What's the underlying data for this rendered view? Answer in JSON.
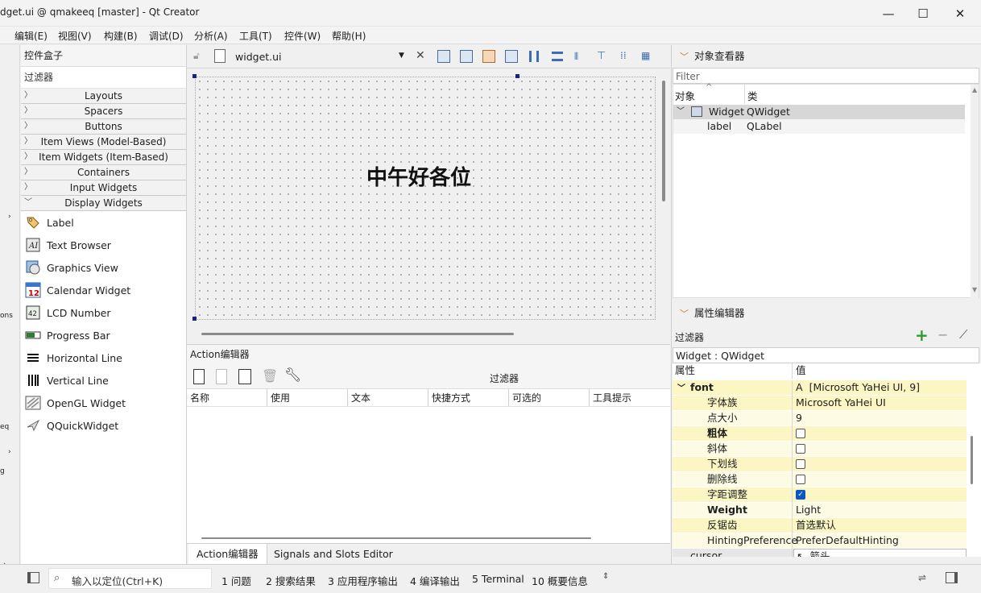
{
  "window": {
    "title": "dget.ui @ qmakeeq [master] - Qt Creator",
    "minimize": "—",
    "maximize": "☐",
    "close": "✕"
  },
  "menu": [
    "编辑(E)",
    "视图(V)",
    "构建(B)",
    "调试(D)",
    "分析(A)",
    "工具(T)",
    "控件(W)",
    "帮助(H)"
  ],
  "leftstrip": {
    "frag1": "ons",
    "frag2": "eq",
    "frag3": "g"
  },
  "widgetbox": {
    "title": "控件盒子",
    "filter": "过滤器",
    "categories": [
      "Layouts",
      "Spacers",
      "Buttons",
      "Item Views (Model-Based)",
      "Item Widgets (Item-Based)",
      "Containers",
      "Input Widgets"
    ],
    "expanded_category": "Display Widgets",
    "items": [
      {
        "label": "Label",
        "icon": "tag-icon"
      },
      {
        "label": "Text Browser",
        "icon": "text-browser-icon"
      },
      {
        "label": "Graphics View",
        "icon": "graphics-view-icon"
      },
      {
        "label": "Calendar Widget",
        "icon": "calendar-icon"
      },
      {
        "label": "LCD Number",
        "icon": "lcd-icon"
      },
      {
        "label": "Progress Bar",
        "icon": "progress-bar-icon"
      },
      {
        "label": "Horizontal Line",
        "icon": "horizontal-line-icon"
      },
      {
        "label": "Vertical Line",
        "icon": "vertical-line-icon"
      },
      {
        "label": "OpenGL Widget",
        "icon": "opengl-icon"
      },
      {
        "label": "QQuickWidget",
        "icon": "quick-widget-icon"
      }
    ],
    "calendar_day": "12",
    "lcd_text": "42"
  },
  "editor": {
    "file": "widget.ui",
    "form_label": "中午好各位"
  },
  "action_editor": {
    "title": "Action编辑器",
    "filter": "过滤器",
    "columns": [
      "名称",
      "使用",
      "文本",
      "快捷方式",
      "可选的",
      "工具提示"
    ],
    "tabs": [
      "Action编辑器",
      "Signals and Slots Editor"
    ]
  },
  "object_inspector": {
    "title": "对象查看器",
    "filter": "Filter",
    "col_object": "对象",
    "col_class": "类",
    "rows": [
      {
        "object": "Widget",
        "class": "QWidget"
      },
      {
        "object": "label",
        "class": "QLabel"
      }
    ]
  },
  "property_editor": {
    "title": "属性编辑器",
    "filter": "过滤器",
    "class_box": "Widget : QWidget",
    "col_prop": "属性",
    "col_value": "值",
    "font_group": "font",
    "font_value": "[Microsoft YaHei UI, 9]",
    "font_value_icon": "A",
    "rows": [
      {
        "name": "字体族",
        "value": "Microsoft YaHei UI",
        "bold": false
      },
      {
        "name": "点大小",
        "value": "9",
        "bold": false
      },
      {
        "name": "粗体",
        "value": "",
        "checkbox": false,
        "bold": true
      },
      {
        "name": "斜体",
        "value": "",
        "checkbox": false,
        "bold": false
      },
      {
        "name": "下划线",
        "value": "",
        "checkbox": false,
        "bold": false
      },
      {
        "name": "删除线",
        "value": "",
        "checkbox": false,
        "bold": false
      },
      {
        "name": "字距调整",
        "value": "",
        "checkbox": true,
        "bold": false
      },
      {
        "name": "Weight",
        "value": "Light",
        "bold": true
      },
      {
        "name": "反锯齿",
        "value": "首选默认",
        "bold": false
      },
      {
        "name": "HintingPreference",
        "value": "PreferDefaultHinting",
        "bold": false
      }
    ],
    "cursor_name": "cursor",
    "cursor_value": "箭头"
  },
  "statusbar": {
    "locator": "输入以定位(Ctrl+K)",
    "items": [
      "1  问题",
      "2  搜索结果",
      "3  应用程序输出",
      "4  编译输出",
      "5  Terminal",
      "10  概要信息"
    ]
  },
  "colors": {
    "highlight": "#fbf6c4",
    "accent": "#0b57c2",
    "selection": "#d7d7d7"
  }
}
